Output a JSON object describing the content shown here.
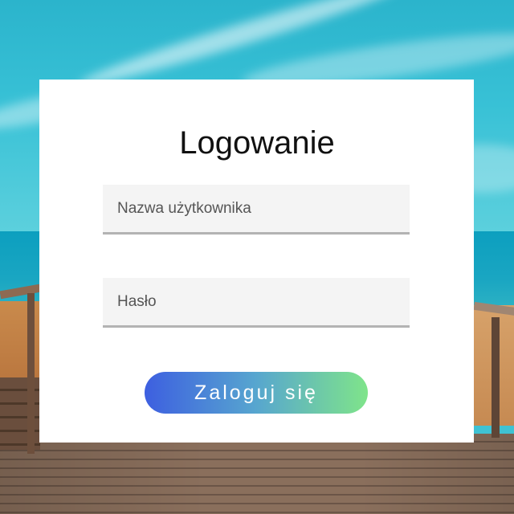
{
  "login": {
    "title": "Logowanie",
    "username_placeholder": "Nazwa użytkownika",
    "username_value": "",
    "password_placeholder": "Hasło",
    "password_value": "",
    "submit_label": "Zaloguj się"
  },
  "colors": {
    "card_background": "#ffffff",
    "input_background": "#f4f4f4",
    "input_underline": "#b3b3b3",
    "button_gradient_start": "#3d5fe0",
    "button_gradient_end": "#7fe48a",
    "title_text": "#111111"
  }
}
